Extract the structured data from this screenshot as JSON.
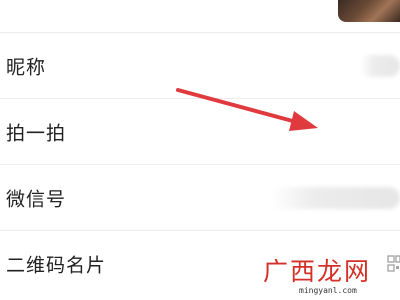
{
  "profile": {
    "rows": [
      {
        "label": "昵称"
      },
      {
        "label": "拍一拍"
      },
      {
        "label": "微信号"
      },
      {
        "label": "二维码名片"
      }
    ]
  },
  "watermark": {
    "text": "广西龙网",
    "url": "mingyanl.com"
  },
  "icons": {
    "avatar": "profile-photo",
    "qr": "qr-code-icon",
    "annotation": "red-arrow"
  },
  "colors": {
    "annotation_arrow": "#e03a3e",
    "watermark_text": "#d33127",
    "divider": "#ededed"
  }
}
